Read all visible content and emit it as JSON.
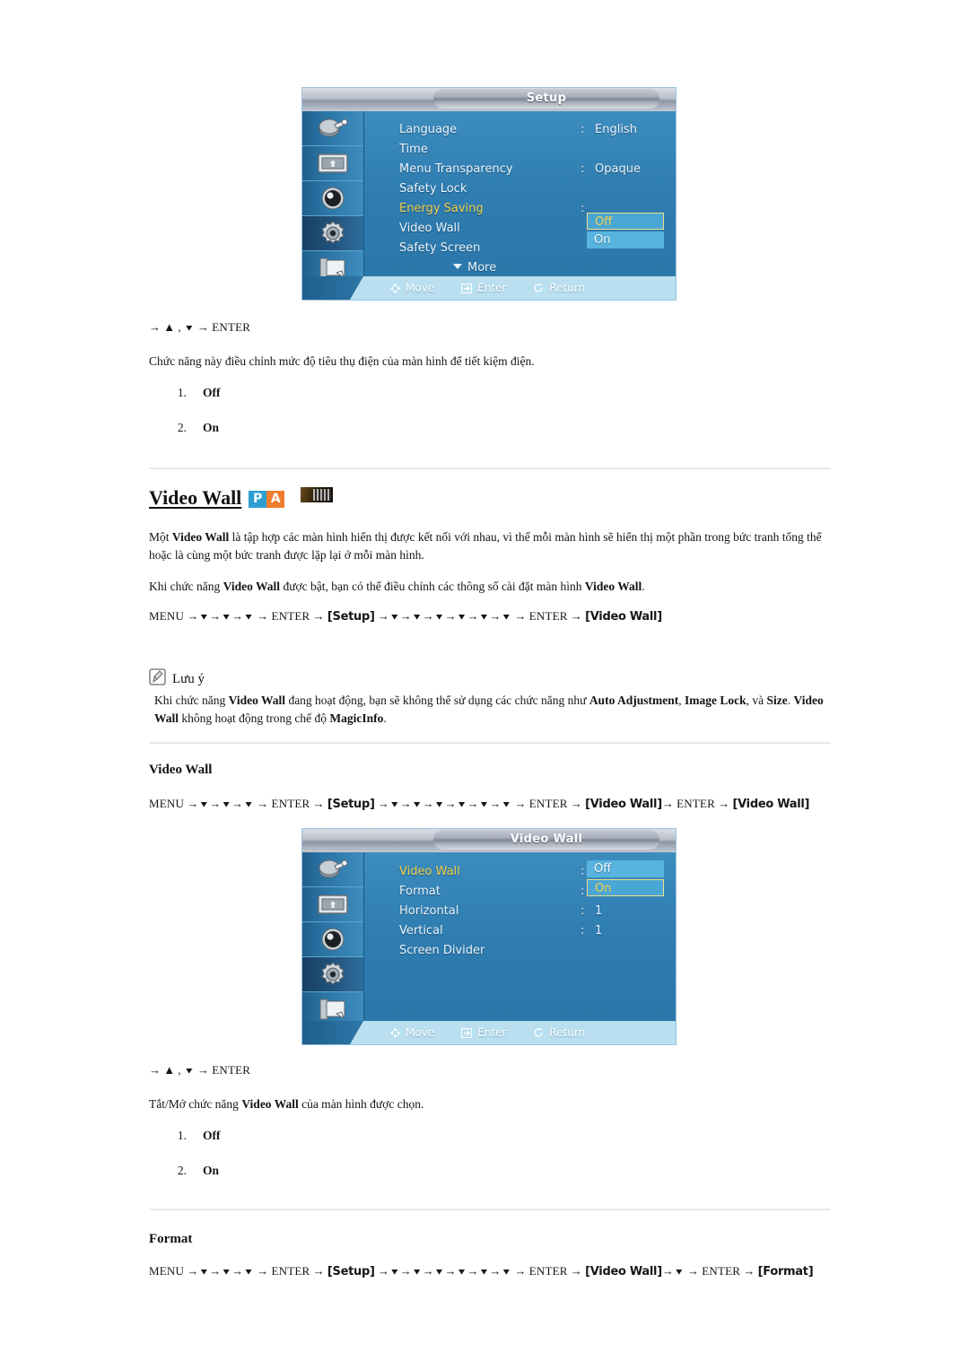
{
  "osd_setup": {
    "title": "Setup",
    "rows": [
      {
        "label": "Language",
        "colon": ":",
        "value": "English",
        "highlight": false
      },
      {
        "label": "Time",
        "colon": "",
        "value": "",
        "highlight": false
      },
      {
        "label": "Menu Transparency",
        "colon": ":",
        "value": "Opaque",
        "highlight": false
      },
      {
        "label": "Safety Lock",
        "colon": "",
        "value": "",
        "highlight": false
      },
      {
        "label": "Energy Saving",
        "colon": ":",
        "value": "",
        "highlight": true
      },
      {
        "label": "Video Wall",
        "colon": "",
        "value": "",
        "highlight": false
      },
      {
        "label": "Safety Screen",
        "colon": "",
        "value": "",
        "highlight": false
      }
    ],
    "more_label": "More",
    "options": [
      {
        "label": "Off",
        "state": "active"
      },
      {
        "label": "On",
        "state": "plain"
      }
    ],
    "footer": [
      {
        "icon": "move-icon",
        "label": "Move"
      },
      {
        "icon": "enter-icon",
        "label": "Enter"
      },
      {
        "icon": "return-icon",
        "label": "Return"
      }
    ],
    "sidebar_icons": [
      "input-source-icon",
      "picture-adjust-icon",
      "sound-icon",
      "setup-gear-icon",
      "multi-control-icon"
    ]
  },
  "section_energy": {
    "nav_line": "→ ▲ , ▼ → ENTER",
    "nav_arrow": "→",
    "nav_up": "▲",
    "nav_comma": ",",
    "nav_down": "▼",
    "nav_arrow2": "→",
    "nav_enter": "ENTER",
    "description": "Chức năng này điều chỉnh mức độ tiêu thụ điện của màn hình để tiết kiệm điện.",
    "items": [
      {
        "num": "1.",
        "label": "Off"
      },
      {
        "num": "2.",
        "label": "On"
      }
    ]
  },
  "heading_video_wall": {
    "title": "Video Wall",
    "badge_p": "P",
    "badge_a": "A",
    "magicinfo_badge": "magicinfo-icon"
  },
  "video_wall_intro": {
    "paragraph1_pre": "Một ",
    "paragraph1_b1": "Video Wall",
    "paragraph1_post": " là tập hợp các màn hình hiển thị được kết nối với nhau, vì thế mỗi màn hình sẽ hiển thị một phần trong bức tranh tổng thể hoặc là cùng một bức tranh được lặp lại ở mỗi màn hình.",
    "paragraph2_pre": "Khi chức năng ",
    "paragraph2_b1": "Video Wall",
    "paragraph2_mid": " được bật, bạn có thể điều chỉnh các thông số cài đặt màn hình ",
    "paragraph2_b2": "Video Wall",
    "paragraph2_post": "."
  },
  "path_video_wall_1": {
    "menu": "MENU",
    "arrow": "→",
    "down": "▼",
    "enter": "ENTER",
    "setup": "[Setup]",
    "target": "[Video Wall]"
  },
  "note": {
    "icon": "note-pencil-icon",
    "title": "Lưu ý",
    "text_pre": "Khi chức năng ",
    "b1": "Video Wall",
    "text_mid1": " đang hoạt động, bạn sẽ không thể sử dụng các chức năng như ",
    "b2": "Auto Adjustment",
    "text_mid2": ", ",
    "b3": "Image Lock",
    "text_mid3": ", và ",
    "b4": "Size",
    "text_mid4": ". ",
    "b5": "Video Wall",
    "text_mid5": " không hoạt động trong chế độ ",
    "b6": "MagicInfo",
    "text_end": "."
  },
  "subsection_video_wall": {
    "title": "Video Wall",
    "path": {
      "menu": "MENU",
      "arrow": "→",
      "down": "▼",
      "enter": "ENTER",
      "setup": "[Setup]",
      "target1": "[Video Wall]",
      "target2": "[Video Wall]"
    }
  },
  "osd_videowall": {
    "title": "Video Wall",
    "rows": [
      {
        "label": "Video Wall",
        "colon": ":",
        "value": "",
        "highlight": true
      },
      {
        "label": "Format",
        "colon": ":",
        "value": "",
        "highlight": false
      },
      {
        "label": "Horizontal",
        "colon": ":",
        "value": "1",
        "highlight": false
      },
      {
        "label": "Vertical",
        "colon": ":",
        "value": "1",
        "highlight": false
      },
      {
        "label": "Screen Divider",
        "colon": "",
        "value": "",
        "highlight": false
      }
    ],
    "options": [
      {
        "label": "Off",
        "state": "plain"
      },
      {
        "label": "On",
        "state": "active"
      }
    ],
    "footer": [
      {
        "icon": "move-icon",
        "label": "Move"
      },
      {
        "icon": "enter-icon",
        "label": "Enter"
      },
      {
        "icon": "return-icon",
        "label": "Return"
      }
    ],
    "sidebar_icons": [
      "input-source-icon",
      "picture-adjust-icon",
      "sound-icon",
      "setup-gear-icon",
      "multi-control-icon"
    ]
  },
  "section_video_wall_desc": {
    "nav_line": "→ ▲ , ▼ → ENTER",
    "description_pre": "Tắt/Mở chức năng ",
    "description_b": "Video Wall",
    "description_post": " của màn hình được chọn.",
    "items": [
      {
        "num": "1.",
        "label": "Off"
      },
      {
        "num": "2.",
        "label": "On"
      }
    ]
  },
  "subsection_format": {
    "title": "Format",
    "path": {
      "menu": "MENU",
      "arrow": "→",
      "down": "▼",
      "enter": "ENTER",
      "setup": "[Setup]",
      "target1": "[Video Wall]",
      "target2": "[Format]"
    }
  },
  "colors": {
    "osd_blue": "#2f7fb5",
    "osd_highlight_yellow": "#f2d14b",
    "osd_option_blue": "#58b3de",
    "badge_p_blue": "#2e9fd4",
    "badge_a_orange": "#ef7e2e",
    "rule_gray": "#e2e2e2"
  }
}
